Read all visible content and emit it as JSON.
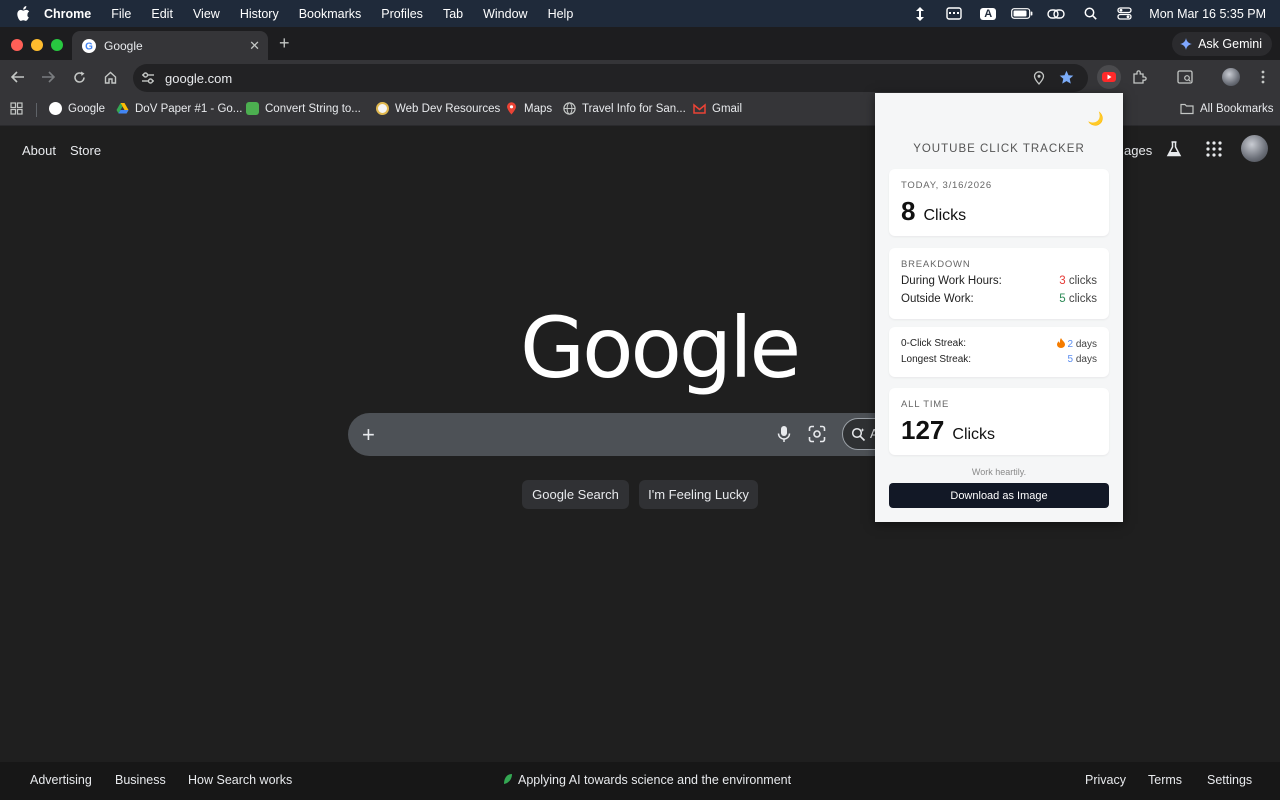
{
  "menubar": {
    "app": "Chrome",
    "items": [
      "File",
      "Edit",
      "View",
      "History",
      "Bookmarks",
      "Profiles",
      "Tab",
      "Window",
      "Help"
    ],
    "input_source": "A",
    "clock": "Mon Mar 16  5:35 PM"
  },
  "tab": {
    "title": "Google"
  },
  "gemini": {
    "label": "Ask Gemini"
  },
  "omnibox": {
    "url": "google.com"
  },
  "bookmarks": {
    "items": [
      "Google",
      "DoV Paper #1 - Go...",
      "Convert String to...",
      "Web Dev Resources",
      "Maps",
      "Travel Info for San...",
      "Gmail"
    ],
    "all": "All Bookmarks"
  },
  "google": {
    "top_links": [
      "About",
      "Store"
    ],
    "images_partial": "ages",
    "logo": "Google",
    "ai_mode_partial": "A",
    "buttons": {
      "search": "Google Search",
      "lucky": "I'm Feeling Lucky"
    },
    "footer": {
      "left": [
        "Advertising",
        "Business",
        "How Search works"
      ],
      "center": "Applying AI towards science and the environment",
      "right": [
        "Privacy",
        "Terms",
        "Settings"
      ]
    }
  },
  "popup": {
    "title": "YOUTUBE CLICK TRACKER",
    "today": {
      "caption": "TODAY, 3/16/2026",
      "count": "8",
      "unit": "Clicks"
    },
    "breakdown": {
      "caption": "BREAKDOWN",
      "work_label": "During Work Hours:",
      "work_count": "3",
      "outside_label": "Outside Work:",
      "outside_count": "5",
      "unit": "clicks"
    },
    "streaks": {
      "zero_label": "0-Click Streak:",
      "zero_value": "2",
      "longest_label": "Longest Streak:",
      "longest_value": "5",
      "unit": "days"
    },
    "all_time": {
      "caption": "ALL TIME",
      "count": "127",
      "unit": "Clicks"
    },
    "motto": "Work heartily.",
    "download_label": "Download as Image"
  },
  "colors": {
    "red_count": "#e53935",
    "green_count": "#2e8b57",
    "blue_count": "#5b8def",
    "button_dark": "#121826"
  }
}
